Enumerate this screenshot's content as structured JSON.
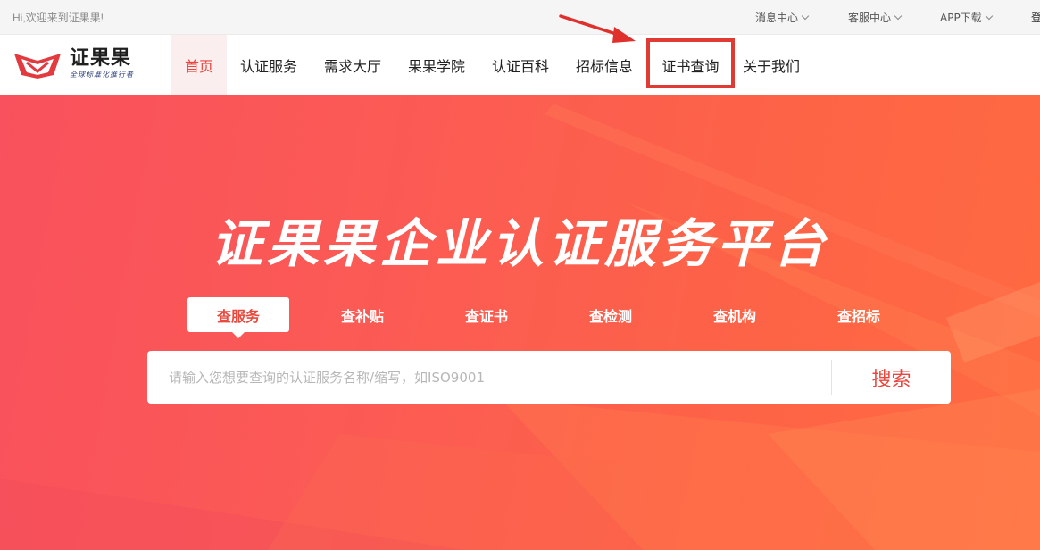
{
  "topbar": {
    "welcome": "Hi,欢迎来到证果果!",
    "links": [
      "消息中心",
      "客服中心",
      "APP下载"
    ],
    "clipped": "登"
  },
  "logo": {
    "name": "证果果",
    "slogan": "全球标准化推行者"
  },
  "nav": {
    "items": [
      "首页",
      "认证服务",
      "需求大厅",
      "果果学院",
      "认证百科",
      "招标信息",
      "证书查询",
      "关于我们"
    ],
    "active_index": 0,
    "highlighted_index": 6
  },
  "hero": {
    "title": "证果果企业认证服务平台",
    "tabs": [
      "查服务",
      "查补贴",
      "查证书",
      "查检测",
      "查机构",
      "查招标"
    ],
    "active_tab": 0,
    "search_placeholder": "请输入您想要查询的认证服务名称/缩写，如ISO9001",
    "search_button": "搜索"
  },
  "colors": {
    "accent": "#e8463e",
    "highlight_box": "#e03a35",
    "hero_start": "#f9515d",
    "hero_end": "#ff6a40"
  }
}
